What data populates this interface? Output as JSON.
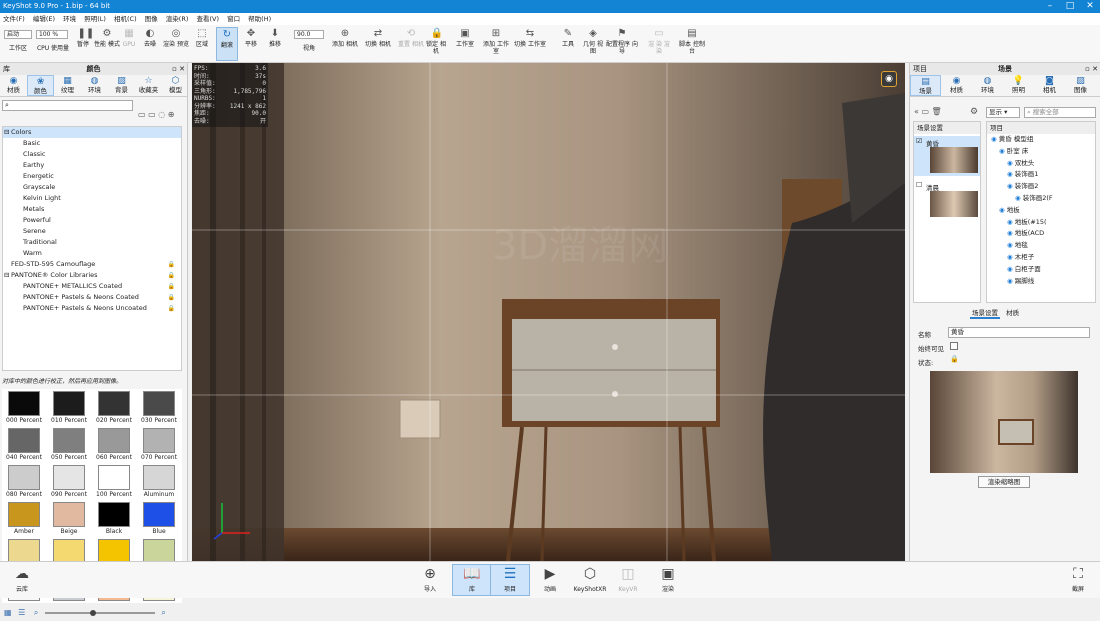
{
  "window": {
    "title": "KeyShot 9.0 Pro  -  1.bip  -  64 bit"
  },
  "menu": [
    "文件(F)",
    "编辑(E)",
    "环境",
    "照明(L)",
    "相机(C)",
    "图像",
    "渲染(R)",
    "查看(V)",
    "窗口",
    "帮助(H)"
  ],
  "ribbon": {
    "workspace_select": "启动",
    "workspace_label": "工作区",
    "cpu_label": "CPU 使用量",
    "zoom_value": "100 %",
    "pause_label": "暂停",
    "perf_label": "性能\n模式",
    "gpu_label": "GPU",
    "denoise_label": "去噪",
    "render_label": "渲染\n预览",
    "region_label": "区域",
    "tumble_label": "翻滚",
    "pan_label": "平移",
    "dolly_label": "推移",
    "fov_value": "90.0",
    "fov_label": "视角",
    "add_camera_label": "添加\n相机",
    "switch_camera_label": "切换\n相机",
    "reset_camera_label": "重置\n相机",
    "lock_camera_label": "锁定\n相机",
    "studio_label": "工作室",
    "add_studio_label": "添加\n工作室",
    "switch_studio_label": "切换\n工作室",
    "tools_label": "工具",
    "geometry_view_label": "几何\n视图",
    "config_label": "配置程序\n向导",
    "ar_label": "渲 染\n渲染",
    "script_label": "脚本\n控制台"
  },
  "left_panel": {
    "title_left": "库",
    "title": "颜色",
    "tabs": [
      "材质",
      "颜色",
      "纹理",
      "环境",
      "背景",
      "收藏夹",
      "模型"
    ],
    "search_placeholder": "",
    "tree": [
      {
        "label": "Colors",
        "level": 0,
        "selected": true
      },
      {
        "label": "Basic",
        "level": 1
      },
      {
        "label": "Classic",
        "level": 1
      },
      {
        "label": "Earthy",
        "level": 1
      },
      {
        "label": "Energetic",
        "level": 1
      },
      {
        "label": "Grayscale",
        "level": 1
      },
      {
        "label": "Kelvin Light",
        "level": 1
      },
      {
        "label": "Metals",
        "level": 1
      },
      {
        "label": "Powerful",
        "level": 1
      },
      {
        "label": "Serene",
        "level": 1
      },
      {
        "label": "Traditional",
        "level": 1
      },
      {
        "label": "Warm",
        "level": 1
      },
      {
        "label": "FED-STD-595 Camouflage",
        "level": 0,
        "locked": true
      },
      {
        "label": "PANTONE® Color Libraries",
        "level": 0,
        "locked": true
      },
      {
        "label": "PANTONE+ METALLICS Coated",
        "level": 1,
        "locked": true
      },
      {
        "label": "PANTONE+ Pastels & Neons Coated",
        "level": 1,
        "locked": true
      },
      {
        "label": "PANTONE+ Pastels & Neons Uncoated",
        "level": 1,
        "locked": true
      }
    ],
    "note": "对库中的颜色进行校正，然后再应用到图像。",
    "swatches": [
      {
        "name": "000 Percent",
        "color": "#0a0a0a"
      },
      {
        "name": "010 Percent",
        "color": "#1c1c1c"
      },
      {
        "name": "020 Percent",
        "color": "#333333"
      },
      {
        "name": "030 Percent",
        "color": "#4a4a4a"
      },
      {
        "name": "040 Percent",
        "color": "#666666"
      },
      {
        "name": "050 Percent",
        "color": "#7f7f7f"
      },
      {
        "name": "060 Percent",
        "color": "#999999"
      },
      {
        "name": "070 Percent",
        "color": "#b2b2b2"
      },
      {
        "name": "080 Percent",
        "color": "#cccccc"
      },
      {
        "name": "090 Percent",
        "color": "#e5e5e5"
      },
      {
        "name": "100 Percent",
        "color": "#ffffff"
      },
      {
        "name": "Aluminum",
        "color": "#d6d6d6"
      },
      {
        "name": "Amber",
        "color": "#c8961c"
      },
      {
        "name": "Beige",
        "color": "#e1b9a0"
      },
      {
        "name": "Black",
        "color": "#000000"
      },
      {
        "name": "Blue",
        "color": "#1e4fe6"
      },
      {
        "name": "Brass",
        "color": "#ecd98f"
      },
      {
        "name": "Bright Am...",
        "color": "#f4d870"
      },
      {
        "name": "Cadmium ...",
        "color": "#f5c400"
      },
      {
        "name": "Charteuse",
        "color": "#c9d59a"
      },
      {
        "name": "",
        "color": "#f7f7f7"
      },
      {
        "name": "",
        "color": "#c9ccd0"
      },
      {
        "name": "",
        "color": "#f3b98f"
      },
      {
        "name": "",
        "color": "#f5f3d8"
      }
    ]
  },
  "viewport": {
    "stats": [
      {
        "k": "FPS:",
        "v": "3.6"
      },
      {
        "k": "时间:",
        "v": "37s"
      },
      {
        "k": "采样值:",
        "v": "0"
      },
      {
        "k": "三角形:",
        "v": "1,785,796"
      },
      {
        "k": "NURBS:",
        "v": "1"
      },
      {
        "k": "分辨率:",
        "v": "1241 x 862"
      },
      {
        "k": "焦距:",
        "v": "90.0"
      },
      {
        "k": "去噪:",
        "v": "开"
      }
    ],
    "watermark": "3D溜溜网"
  },
  "right_panel": {
    "title_left": "项目",
    "title": "场景",
    "tabs": [
      "场景",
      "材质",
      "环境",
      "照明",
      "相机",
      "图像"
    ],
    "display_select": "显示",
    "search_placeholder": "搜索全部",
    "scene_settings_header": "场景设置",
    "item_header": "项目",
    "scene_sets": [
      {
        "label": "黄昏",
        "checked": true
      },
      {
        "label": "清晨",
        "checked": false
      }
    ],
    "items": [
      {
        "label": "黄昏 模型组",
        "level": 0
      },
      {
        "label": "卧室 床",
        "level": 1
      },
      {
        "label": "双枕头",
        "level": 2
      },
      {
        "label": "装饰画1",
        "level": 2
      },
      {
        "label": "装饰画2",
        "level": 2
      },
      {
        "label": "装饰画2(F",
        "level": 3
      },
      {
        "label": "地板",
        "level": 1
      },
      {
        "label": "地板(#15(",
        "level": 2
      },
      {
        "label": "地板(ACD",
        "level": 2
      },
      {
        "label": "地毯",
        "level": 2
      },
      {
        "label": "木柜子",
        "level": 2
      },
      {
        "label": "白柜子面",
        "level": 2
      },
      {
        "label": "踢脚线",
        "level": 2
      }
    ],
    "subtabs": [
      "场景设置",
      "材质"
    ],
    "name_label": "名称",
    "name_value": "黄昏",
    "always_visible_label": "始终可见",
    "state_label": "状态:",
    "render_thumb_button": "渲染缩略图"
  },
  "dock": {
    "cloud_label": "云库",
    "items": [
      "导入",
      "库",
      "项目",
      "动画",
      "KeyShotXR",
      "KeyVR",
      "渲染"
    ],
    "screenshot_label": "截屏"
  }
}
